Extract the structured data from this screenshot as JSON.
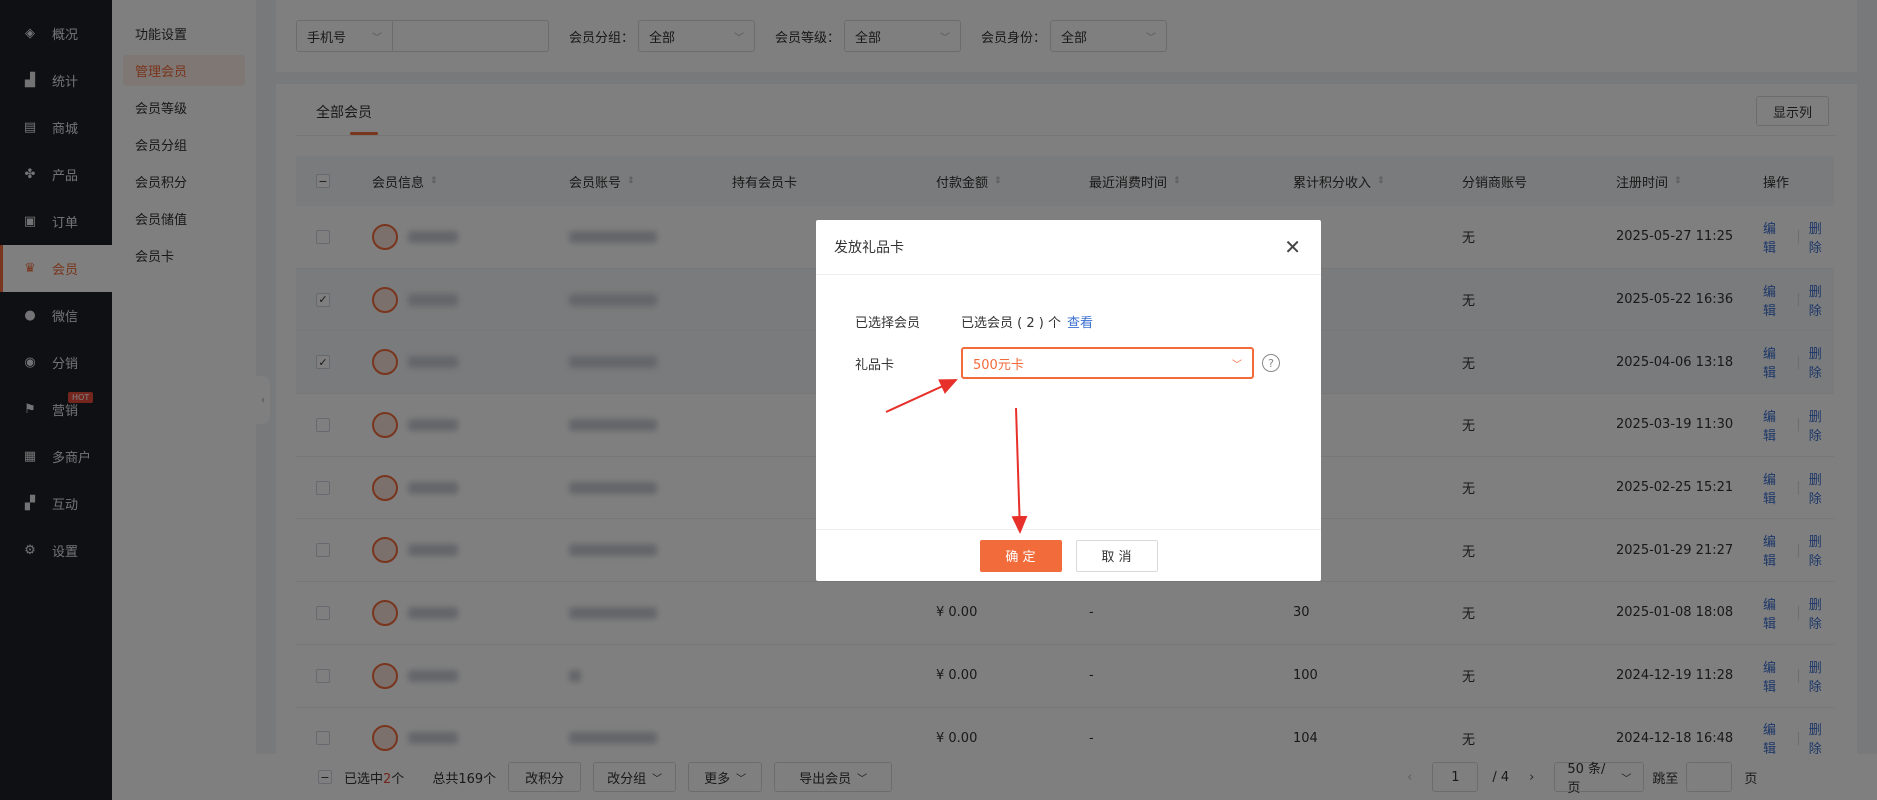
{
  "nav": {
    "items": [
      {
        "label": "概况",
        "icon": "layers-icon"
      },
      {
        "label": "统计",
        "icon": "chart-icon"
      },
      {
        "label": "商城",
        "icon": "store-icon"
      },
      {
        "label": "产品",
        "icon": "grid-icon"
      },
      {
        "label": "订单",
        "icon": "clipboard-icon"
      },
      {
        "label": "会员",
        "icon": "crown-icon"
      },
      {
        "label": "微信",
        "icon": "chat-icon"
      },
      {
        "label": "分销",
        "icon": "users-icon"
      },
      {
        "label": "营销",
        "icon": "flag-icon",
        "badge": "HOT"
      },
      {
        "label": "多商户",
        "icon": "shop-icon"
      },
      {
        "label": "互动",
        "icon": "apps-icon"
      },
      {
        "label": "设置",
        "icon": "gear-icon"
      }
    ],
    "active": "会员"
  },
  "subnav": {
    "items": [
      "功能设置",
      "管理会员",
      "会员等级",
      "会员分组",
      "会员积分",
      "会员储值",
      "会员卡"
    ],
    "active": "管理会员"
  },
  "filters": {
    "phone_select": "手机号",
    "group_label": "会员分组：",
    "group_value": "全部",
    "level_label": "会员等级：",
    "level_value": "全部",
    "identity_label": "会员身份：",
    "identity_value": "全部"
  },
  "tabs": {
    "all_members": "全部会员"
  },
  "show_columns": "显示列",
  "table": {
    "headers": [
      "会员信息",
      "会员账号",
      "持有会员卡",
      "付款金额",
      "最近消费时间",
      "累计积分收入",
      "分销商账号",
      "注册时间",
      "操作"
    ],
    "rows": [
      {
        "selected": false,
        "amount": "",
        "last": "",
        "points": "",
        "dist": "无",
        "reg": "2025-05-27 11:25"
      },
      {
        "selected": true,
        "amount": "",
        "last": "",
        "points": "",
        "dist": "无",
        "reg": "2025-05-22 16:36"
      },
      {
        "selected": true,
        "amount": "",
        "last": "",
        "points": "",
        "dist": "无",
        "reg": "2025-04-06 13:18"
      },
      {
        "selected": false,
        "amount": "",
        "last": "",
        "points": "",
        "dist": "无",
        "reg": "2025-03-19 11:30"
      },
      {
        "selected": false,
        "amount": "",
        "last": "",
        "points": "",
        "dist": "无",
        "reg": "2025-02-25 15:21"
      },
      {
        "selected": false,
        "amount": "",
        "last": "",
        "points": "",
        "dist": "无",
        "reg": "2025-01-29 21:27"
      },
      {
        "selected": false,
        "amount": "¥ 0.00",
        "last": "-",
        "points": "30",
        "dist": "无",
        "reg": "2025-01-08 18:08"
      },
      {
        "selected": false,
        "amount": "¥ 0.00",
        "last": "-",
        "points": "100",
        "dist": "无",
        "reg": "2024-12-19 11:28"
      },
      {
        "selected": false,
        "amount": "¥ 0.00",
        "last": "-",
        "points": "104",
        "dist": "无",
        "reg": "2024-12-18 16:48"
      }
    ],
    "edit": "编辑",
    "delete": "删除"
  },
  "footer": {
    "selected_prefix": "已选中",
    "selected_count": "2",
    "selected_suffix": "个",
    "total": "总共169个",
    "btn_points": "改积分",
    "btn_group": "改分组",
    "btn_more": "更多",
    "btn_export": "导出会员",
    "page_current": "1",
    "page_total": "/ 4",
    "page_size": "50 条/页",
    "jump_label": "跳至",
    "page_unit": "页"
  },
  "modal": {
    "title": "发放礼品卡",
    "selected_label": "已选择会员",
    "selected_text": "已选会员 ( 2 ) 个",
    "view_link": "查看",
    "gift_label": "礼品卡",
    "gift_value": "500元卡",
    "ok": "确 定",
    "cancel": "取 消"
  },
  "colors": {
    "accent": "#f26b3a",
    "link": "#3b6fd1",
    "nav_bg": "#1f2127"
  }
}
